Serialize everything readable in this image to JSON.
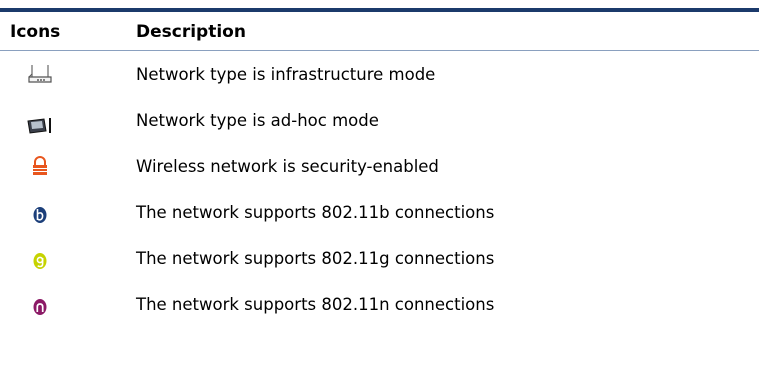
{
  "header": {
    "icons_label": "Icons",
    "description_label": "Description"
  },
  "rows": [
    {
      "icon": "infrastructure-router-icon",
      "description": "Network type is infrastructure mode"
    },
    {
      "icon": "adhoc-card-icon",
      "description": "Network type is ad-hoc mode"
    },
    {
      "icon": "lock-icon",
      "description": "Wireless network is security-enabled"
    },
    {
      "icon": "b-badge-icon",
      "description": "The network supports 802.11b connections"
    },
    {
      "icon": "g-badge-icon",
      "description": "The network supports 802.11g connections"
    },
    {
      "icon": "n-badge-icon",
      "description": "The network supports 802.11n connections"
    }
  ],
  "colors": {
    "rule": "#1b3a6b",
    "lock": "#e8561e",
    "b": "#1c3f7a",
    "g": "#c6d300",
    "n": "#8c1a66"
  }
}
